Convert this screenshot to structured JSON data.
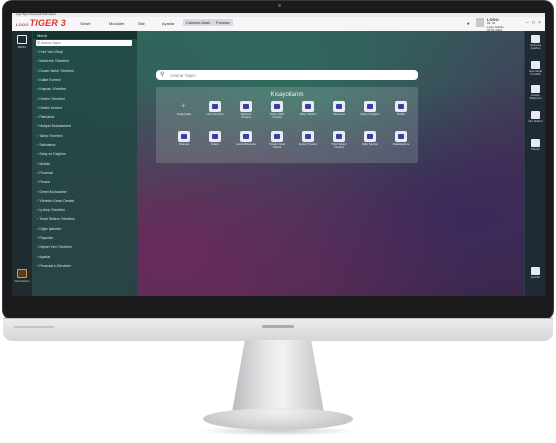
{
  "window": {
    "title": "Logo Tiger 3 Kurumsal Ticari Sistem"
  },
  "brand": {
    "prefix": "LOGO",
    "name": "TIGER 3"
  },
  "menubar": {
    "items": [
      "Sirket",
      "Moduller",
      "Site",
      "Ayarlar"
    ],
    "tabs": [
      "Calisma Alani",
      "Formlar"
    ]
  },
  "user": {
    "name": "LOGO",
    "line1": "01, 01",
    "line2": "Logo Yazilim",
    "line3": "01.01.2023"
  },
  "left_rail": {
    "menu_label": "MENU",
    "bottom_label": "Favorilerim"
  },
  "menu_panel": {
    "title": "Menü",
    "search_placeholder": "Arama Yapın",
    "items": [
      "Hızlı Veri Girişi",
      "Malzeme Yönetimi",
      "Duran Varlık Yönetimi",
      "Kalite Kontrol",
      "Kaynak Yönetimi",
      "Üretim Yönetimi",
      "Üretim Kontrol",
      "Planlama",
      "Maliyet Muhasebesi",
      "Talep Yönetimi",
      "Satınalma",
      "Satış ve Dağıtım",
      "Mutfak",
      "Finansal",
      "Finans",
      "Genel Muhasebe",
      "Yönetim Karar Destek",
      "İş Akış Yönetimi",
      "Ticari Sistem Yönetimi",
      "Diğer İşlemler",
      "Raporlar",
      "Kişisel Veri Yönetimi",
      "Ayarlar",
      "Finansal e-Servisler"
    ]
  },
  "main": {
    "search_placeholder": "Arama Yapın",
    "shortcuts_title": "Kısayollarım",
    "tiles_row1": [
      "Kısayol Ekle",
      "Hızlı Veri Girişi",
      "Malzeme Yönetimi",
      "Duran Varlık Yönetimi",
      "Talep Yönetimi",
      "Satınalma",
      "Satış ve Dağıtım",
      "Mutfak"
    ],
    "tiles_row2": [
      "Finansal",
      "Finans",
      "Genel Muhasebe",
      "Yönetim Karar Destek",
      "İş Akış Yönetimi",
      "Ticari Sistem Yönetimi",
      "Diğer İşlemler",
      "Kişiselleştirme"
    ]
  },
  "right_rail": {
    "items": [
      "Çalışma Ayarları",
      "Hiyerarşik Kurallar",
      "Hesap Makinesi",
      "Not Defteri",
      "Takvim"
    ],
    "bottom": "Ayarlar"
  }
}
